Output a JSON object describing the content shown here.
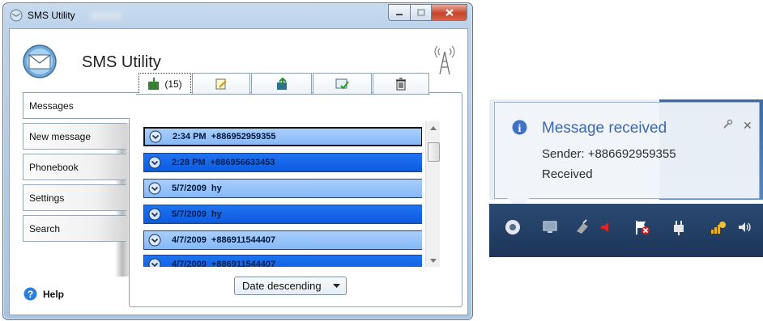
{
  "window": {
    "title": "SMS Utility",
    "app_title": "SMS Utility"
  },
  "sidebar": {
    "items": [
      {
        "label": "Messages",
        "active": true
      },
      {
        "label": "New message",
        "active": false
      },
      {
        "label": "Phonebook",
        "active": false
      },
      {
        "label": "Settings",
        "active": false
      },
      {
        "label": "Search",
        "active": false
      }
    ],
    "help_label": "Help"
  },
  "toolbar": {
    "inbox_count": "(15)",
    "icons": [
      "inbox-icon",
      "compose-icon",
      "outbox-icon",
      "sent-icon",
      "trash-icon"
    ]
  },
  "messages": [
    {
      "text": "2:34 PM  +886952959355",
      "style": "light",
      "selected": true
    },
    {
      "text": "2:28 PM  +886956633453",
      "style": "dark",
      "selected": false
    },
    {
      "text": "5/7/2009  hy",
      "style": "light",
      "selected": false
    },
    {
      "text": "5/7/2009  hy",
      "style": "dark",
      "selected": false
    },
    {
      "text": "4/7/2009  +886911544407",
      "style": "light",
      "selected": false
    },
    {
      "text": "4/7/2009  +886911544407",
      "style": "dark",
      "selected": false
    }
  ],
  "sort": {
    "value": "Date descending"
  },
  "notification": {
    "title": "Message received",
    "sender": "Sender: +886692959355",
    "status": "Received"
  },
  "colors": {
    "row_light": "#94c2f8",
    "row_dark": "#1566e8",
    "toast_title": "#3d66b0",
    "taskbar": "#244266"
  }
}
